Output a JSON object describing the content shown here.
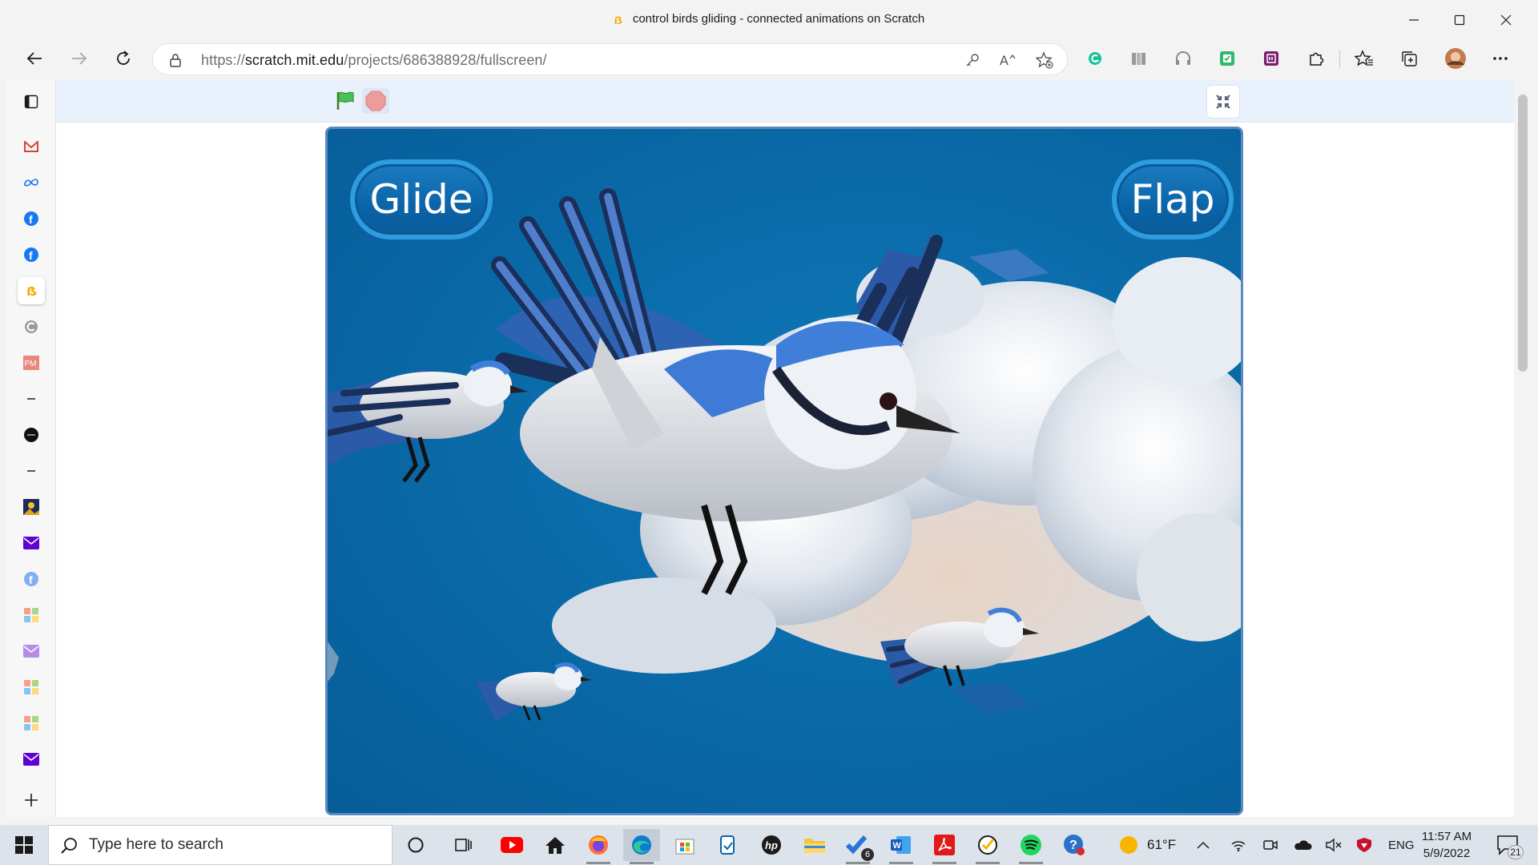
{
  "window": {
    "title": "control birds gliding - connected animations on Scratch"
  },
  "toolbar": {
    "url_scheme": "https://",
    "url_host": "scratch.mit.edu",
    "url_path": "/projects/686388928/fullscreen/"
  },
  "stage": {
    "glide_label": "Glide",
    "flap_label": "Flap",
    "colors": {
      "sky": "#0a6aa8",
      "button_border": "#2f9be0"
    }
  },
  "taskbar": {
    "search_placeholder": "Type here to search",
    "todo_badge": "6",
    "weather": "61°F",
    "language": "ENG",
    "time": "11:57 AM",
    "date": "5/9/2022",
    "notification_count": "21"
  }
}
